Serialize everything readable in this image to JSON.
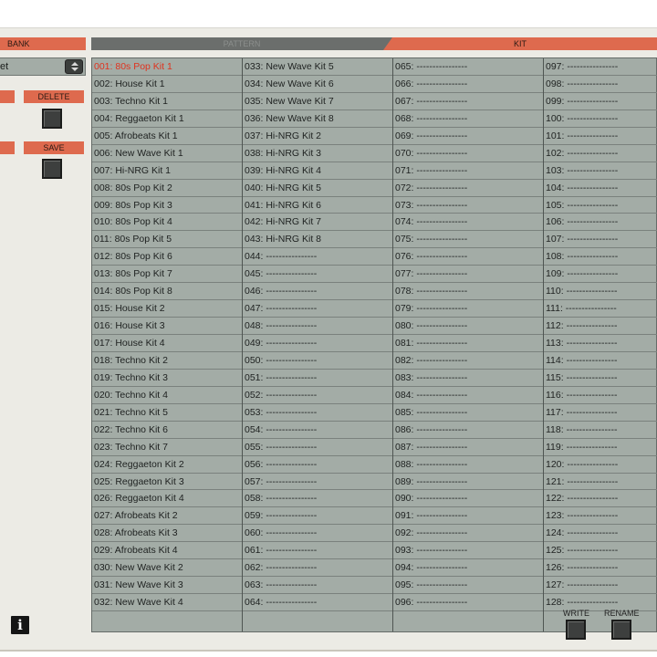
{
  "header": {
    "bank": "BANK",
    "pattern": "PATTERN",
    "kit": "KIT"
  },
  "kit_selector": {
    "value": "et"
  },
  "buttons": {
    "delete": "DELETE",
    "save": "SAVE",
    "write": "WRITE",
    "rename": "RENAME",
    "info": "i"
  },
  "kit_list": {
    "selected_index": 0,
    "columns": [
      [
        "001: 80s Pop Kit 1",
        "002: House Kit 1",
        "003: Techno Kit 1",
        "004: Reggaeton Kit 1",
        "005: Afrobeats Kit 1",
        "006: New Wave Kit 1",
        "007: Hi-NRG Kit 1",
        "008: 80s Pop Kit 2",
        "009: 80s Pop Kit 3",
        "010: 80s Pop Kit 4",
        "011: 80s Pop Kit 5",
        "012: 80s Pop Kit 6",
        "013: 80s Pop Kit 7",
        "014: 80s Pop Kit 8",
        "015: House Kit 2",
        "016: House Kit 3",
        "017: House Kit 4",
        "018: Techno Kit 2",
        "019: Techno Kit 3",
        "020: Techno Kit 4",
        "021: Techno Kit 5",
        "022: Techno Kit 6",
        "023: Techno Kit 7",
        "024: Reggaeton Kit 2",
        "025: Reggaeton Kit 3",
        "026: Reggaeton Kit 4",
        "027: Afrobeats Kit 2",
        "028: Afrobeats Kit 3",
        "029: Afrobeats Kit 4",
        "030: New Wave Kit 2",
        "031: New Wave Kit 3",
        "032: New Wave Kit 4"
      ],
      [
        "033: New Wave Kit 5",
        "034: New Wave Kit 6",
        "035: New Wave Kit 7",
        "036: New Wave Kit 8",
        "037: Hi-NRG Kit 2",
        "038: Hi-NRG Kit 3",
        "039: Hi-NRG Kit 4",
        "040: Hi-NRG Kit 5",
        "041: Hi-NRG Kit 6",
        "042: Hi-NRG Kit 7",
        "043: Hi-NRG Kit 8",
        "044: ----------------",
        "045: ----------------",
        "046: ----------------",
        "047: ----------------",
        "048: ----------------",
        "049: ----------------",
        "050: ----------------",
        "051: ----------------",
        "052: ----------------",
        "053: ----------------",
        "054: ----------------",
        "055: ----------------",
        "056: ----------------",
        "057: ----------------",
        "058: ----------------",
        "059: ----------------",
        "060: ----------------",
        "061: ----------------",
        "062: ----------------",
        "063: ----------------",
        "064: ----------------"
      ],
      [
        "065: ----------------",
        "066: ----------------",
        "067: ----------------",
        "068: ----------------",
        "069: ----------------",
        "070: ----------------",
        "071: ----------------",
        "072: ----------------",
        "073: ----------------",
        "074: ----------------",
        "075: ----------------",
        "076: ----------------",
        "077: ----------------",
        "078: ----------------",
        "079: ----------------",
        "080: ----------------",
        "081: ----------------",
        "082: ----------------",
        "083: ----------------",
        "084: ----------------",
        "085: ----------------",
        "086: ----------------",
        "087: ----------------",
        "088: ----------------",
        "089: ----------------",
        "090: ----------------",
        "091: ----------------",
        "092: ----------------",
        "093: ----------------",
        "094: ----------------",
        "095: ----------------",
        "096: ----------------"
      ],
      [
        "097: ----------------",
        "098: ----------------",
        "099: ----------------",
        "100: ----------------",
        "101: ----------------",
        "102: ----------------",
        "103: ----------------",
        "104: ----------------",
        "105: ----------------",
        "106: ----------------",
        "107: ----------------",
        "108: ----------------",
        "109: ----------------",
        "110: ----------------",
        "111: ----------------",
        "112: ----------------",
        "113: ----------------",
        "114: ----------------",
        "115: ----------------",
        "116: ----------------",
        "117: ----------------",
        "118: ----------------",
        "119: ----------------",
        "120: ----------------",
        "121: ----------------",
        "122: ----------------",
        "123: ----------------",
        "124: ----------------",
        "125: ----------------",
        "126: ----------------",
        "127: ----------------",
        "128: ----------------"
      ]
    ]
  },
  "colors": {
    "accent": "#de6a4e",
    "list_bg": "#a3aca6",
    "selected_text": "#e0321e"
  }
}
